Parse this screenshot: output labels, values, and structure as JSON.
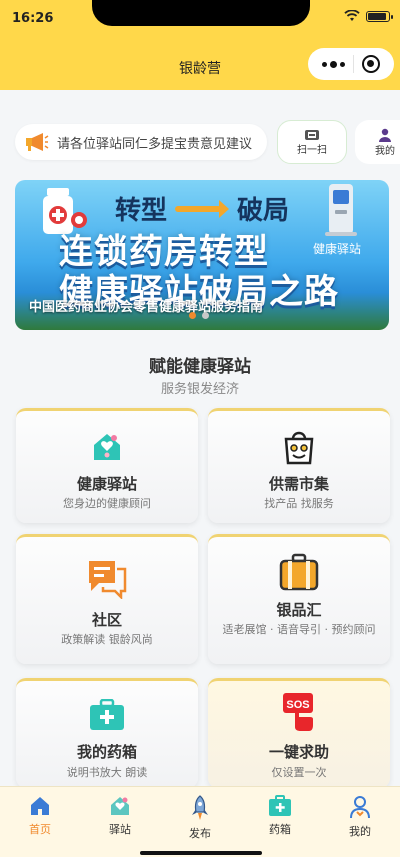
{
  "status": {
    "time": "16:26"
  },
  "header": {
    "title": "银龄营"
  },
  "notice": {
    "text": "请各位驿站同仁多提宝贵意见建议"
  },
  "quick": {
    "scan_label": "扫一扫",
    "mine_label": "我的"
  },
  "banner": {
    "top_left": "转型",
    "top_right": "破局",
    "line1": "连锁药房转型",
    "line2": "健康驿站破局之路",
    "tag": "健康驿站",
    "caption": "中国医药商业协会零售健康驿站服务指南"
  },
  "section": {
    "title": "赋能健康驿站",
    "subtitle": "服务银发经济"
  },
  "cards": [
    {
      "title": "健康驿站",
      "desc": "您身边的健康顾问"
    },
    {
      "title": "供需市集",
      "desc": "找产品 找服务"
    },
    {
      "title": "社区",
      "desc": "政策解读 银龄风尚"
    },
    {
      "title": "银品汇",
      "desc": "适老展馆 · 语音导引 · 预约顾问"
    },
    {
      "title": "我的药箱",
      "desc": "说明书放大 朗读"
    },
    {
      "title": "一键求助",
      "desc": "仅设置一次"
    }
  ],
  "tabs": [
    {
      "label": "首页",
      "icon": "home-icon"
    },
    {
      "label": "驿站",
      "icon": "station-icon"
    },
    {
      "label": "发布",
      "icon": "rocket-icon"
    },
    {
      "label": "药箱",
      "icon": "medkit-icon"
    },
    {
      "label": "我的",
      "icon": "user-icon"
    }
  ],
  "colors": {
    "header": "#ffd84a",
    "accent": "#f08a2e",
    "teal": "#2ec4b6"
  }
}
